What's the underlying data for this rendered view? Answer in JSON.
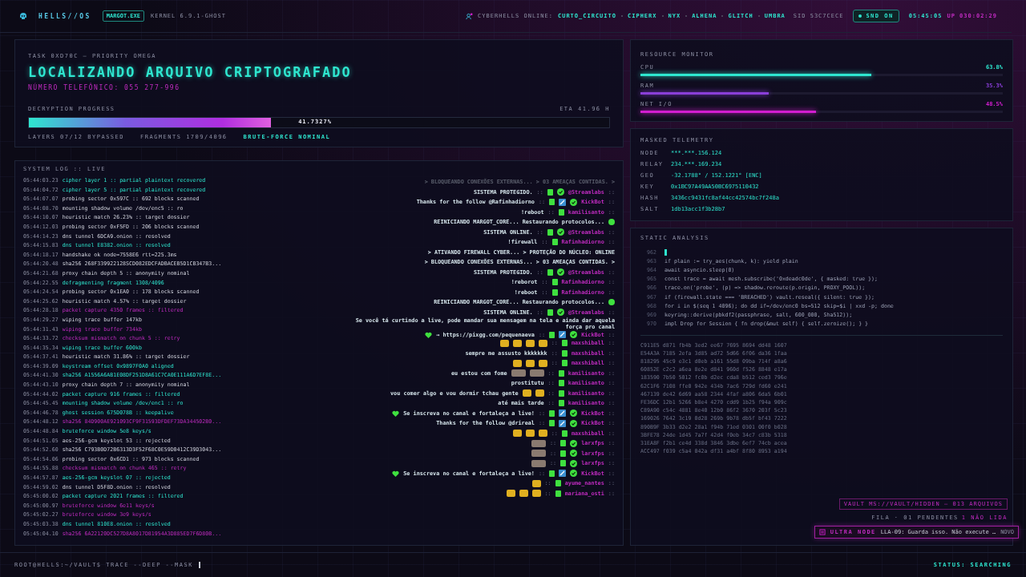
{
  "top_bar": {
    "brand": "HELLS//OS",
    "process": "MARGOT.EXE",
    "kernel": "KERNEL 6.9.1-GHOST",
    "online_label": "CYBERHELLS ONLINE:",
    "online_users": [
      "CURTO_CIRCUITO",
      "CIPHERX",
      "NYX",
      "ALHENA",
      "GLITCH",
      "UMBRA"
    ],
    "sid": "SID 53C7CECE",
    "sound": {
      "label": "SND ON",
      "on": true
    },
    "clock": "05:45:05",
    "uptime": "UP 030:02:29"
  },
  "task": {
    "eyebrow": "TASK 0XD70C — PRIORITY OMEGA",
    "title": "LOCALIZANDO ARQUIVO CRIPTOGRAFADO",
    "subtitle": "NÚMERO TELEFÔNICO: 055 277-996",
    "progress": {
      "label": "DECRYPTION PROGRESS",
      "eta": "ETA 41.96 H",
      "level": 0.417327,
      "reading": "41.7327%"
    },
    "footer": [
      {
        "text": "LAYERS 07/12 BYPASSED",
        "kind": "muted"
      },
      {
        "text": "FRAGMENTS 1709/4096",
        "kind": "muted"
      },
      {
        "text": "BRUTE-FORCE NOMINAL",
        "kind": "ok"
      }
    ]
  },
  "system_log": {
    "title": "SYSTEM LOG :: LIVE",
    "lines": [
      {
        "time": "05:44:03.23",
        "text": "cipher layer 1 :: partial plaintext recovered",
        "kind": "ok"
      },
      {
        "time": "05:44:04.72",
        "text": "cipher layer 5 :: partial plaintext recovered",
        "kind": "ok"
      },
      {
        "time": "05:44:07.07",
        "text": "probing sector 0x597C :: 692 blocks scanned",
        "kind": "normal"
      },
      {
        "time": "05:44:08.70",
        "text": "mounting shadow volume /dev/enc5 :: ro",
        "kind": "normal"
      },
      {
        "time": "05:44:10.07",
        "text": "heuristic match 26.23% :: target dossier",
        "kind": "normal"
      },
      {
        "time": "05:44:12.03",
        "text": "probing sector 0xF5FD :: 206 blocks scanned",
        "kind": "normal"
      },
      {
        "time": "05:44:14.23",
        "text": "dns tunnel 6DCA9.onion :: resolved",
        "kind": "normal"
      },
      {
        "time": "05:44:15.83",
        "text": "dns tunnel E8382.onion :: resolved",
        "kind": "ok"
      },
      {
        "time": "05:44:18.17",
        "text": "handshake ok node=7558E6 rtt=225.3ms",
        "kind": "normal"
      },
      {
        "time": "05:44:20.48",
        "text": "sha256 268F339922128SCD082EDCFADBACEB5D1CB347B3...",
        "kind": "normal"
      },
      {
        "time": "05:44:21.68",
        "text": "proxy chain depth 5 :: anonymity nominal",
        "kind": "normal"
      },
      {
        "time": "05:44:22.55",
        "text": "defragmenting fragment 1308/4096",
        "kind": "ok"
      },
      {
        "time": "05:44:24.54",
        "text": "probing sector 0x1EA0 :: 178 blocks scanned",
        "kind": "normal"
      },
      {
        "time": "05:44:25.62",
        "text": "heuristic match 4.57% :: target dossier",
        "kind": "normal"
      },
      {
        "time": "05:44:28.18",
        "text": "packet capture 4350 frames :: filtered",
        "kind": "alert"
      },
      {
        "time": "05:44:29.27",
        "text": "wiping trace buffer 147kb",
        "kind": "normal"
      },
      {
        "time": "05:44:31.43",
        "text": "wiping trace buffer 734kb",
        "kind": "alert"
      },
      {
        "time": "05:44:33.72",
        "text": "checksum mismatch on chunk 5 :: retry",
        "kind": "alert"
      },
      {
        "time": "05:44:35.34",
        "text": "wiping trace buffer 600kb",
        "kind": "ok"
      },
      {
        "time": "05:44:37.41",
        "text": "heuristic match 31.86% :: target dossier",
        "kind": "normal"
      },
      {
        "time": "05:44:39.09",
        "text": "keystream offset 0x9897F0A0 aligned",
        "kind": "ok"
      },
      {
        "time": "05:44:41.30",
        "text": "sha256 A1556A6AB1E08DF251D8A61C7CA0E111A6D7EF8E...",
        "kind": "ok"
      },
      {
        "time": "05:44:43.10",
        "text": "proxy chain depth 7 :: anonymity nominal",
        "kind": "normal"
      },
      {
        "time": "05:44:44.02",
        "text": "packet capture 916 frames :: filtered",
        "kind": "ok"
      },
      {
        "time": "05:44:45.45",
        "text": "mounting shadow volume /dev/enc1 :: ro",
        "kind": "ok"
      },
      {
        "time": "05:44:46.78",
        "text": "ghost session 675D078B :: keepalive",
        "kind": "ok"
      },
      {
        "time": "05:44:48.12",
        "text": "sha256 84D900AE921093CF9F31593DFDEF73DA344502B0...",
        "kind": "alert"
      },
      {
        "time": "05:44:48.84",
        "text": "bruteforce window 5e8 keys/s",
        "kind": "ok"
      },
      {
        "time": "05:44:51.05",
        "text": "aes-256-gcm keyslot 53 :: rejected",
        "kind": "normal"
      },
      {
        "time": "05:44:52.60",
        "text": "sha256 C793B0D72B6313D3F52F68C0E59D0412C39D3043...",
        "kind": "normal"
      },
      {
        "time": "05:44:54.06",
        "text": "probing sector 0x6CD1 :: 973 blocks scanned",
        "kind": "normal"
      },
      {
        "time": "05:44:55.88",
        "text": "checksum mismatch on chunk 465 :: retry",
        "kind": "alert"
      },
      {
        "time": "05:44:57.87",
        "text": "aes-256-gcm keyslot 07 :: rejected",
        "kind": "ok"
      },
      {
        "time": "05:44:59.02",
        "text": "dns tunnel D5F8D.onion :: resolved",
        "kind": "normal"
      },
      {
        "time": "05:45:00.02",
        "text": "packet capture 2021 frames :: filtered",
        "kind": "ok"
      },
      {
        "time": "05:45:00.97",
        "text": "bruteforce window 6e11 keys/s",
        "kind": "alert"
      },
      {
        "time": "05:45:02.27",
        "text": "bruteforce window 3e9 keys/s",
        "kind": "alert"
      },
      {
        "time": "05:45:03.38",
        "text": "dns tunnel 810E8.onion :: resolved",
        "kind": "ok"
      },
      {
        "time": "05:45:04.10",
        "text": "sha256 6A22120DC527D8A8017D81954A3D885ED7F6D80B...",
        "kind": "alert"
      }
    ]
  },
  "chat": {
    "separator": "::",
    "messages": [
      {
        "kind": "system",
        "text": "> BLOQUEANDO CONEXÕES EXTERNAS... > 03 AMEAÇAS CONTIDAS. >"
      },
      {
        "kind": "chat",
        "text": "SISTEMA PROTEGIDO.",
        "user": "@Streamlabs",
        "verified": true,
        "moderator": false
      },
      {
        "kind": "chat",
        "text": "Thanks for the follow @Rafinhadiorno",
        "user": "KickBot",
        "verified": true,
        "moderator": true
      },
      {
        "kind": "chat",
        "text": "!reboot",
        "user": "kamilisanto",
        "verified": false,
        "moderator": false
      },
      {
        "kind": "status",
        "text": "REINICIANDO MARGOT_CORE... Restaurando protocolos..."
      },
      {
        "kind": "chat",
        "text": "SISTEMA ONLINE.",
        "user": "@Streamlabs",
        "verified": true,
        "moderator": false
      },
      {
        "kind": "chat",
        "text": "!firewall",
        "user": "Rafinhadiorno",
        "verified": false,
        "moderator": false
      },
      {
        "kind": "system",
        "text": "> ATIVANDO FIREWALL CYBER... > PROTEÇÃO DO NÚCLEO: ONLINE"
      },
      {
        "kind": "system",
        "text": "> BLOQUEANDO CONEXÕES EXTERNAS... > 03 AMEAÇAS CONTIDAS. >"
      },
      {
        "kind": "chat",
        "text": "SISTEMA PROTEGIDO.",
        "user": "@Streamlabs",
        "verified": true,
        "moderator": false
      },
      {
        "kind": "chat",
        "text": "!reborot",
        "user": "Rafinhadiorno",
        "verified": false,
        "moderator": false
      },
      {
        "kind": "chat",
        "text": "!reboot",
        "user": "Rafinhadiorno",
        "verified": false,
        "moderator": false
      },
      {
        "kind": "status",
        "text": "REINICIANDO MARGOT_CORE... Restaurando protocolos..."
      },
      {
        "kind": "chat",
        "text": "SISTEMA ONLINE.",
        "user": "@Streamlabs",
        "verified": true,
        "moderator": false
      },
      {
        "kind": "chat",
        "text": "Se você tá curtindo a live, pode mandar sua mensagem na tela e ainda dar aquela força pro canal",
        "heart_after": true,
        "link": "→ https://pixgg.com/pequenaeva",
        "user": "KickBot",
        "verified": true,
        "moderator": true
      },
      {
        "kind": "chat",
        "emotes": [
          {
            "kind": "sticker"
          },
          {
            "kind": "sticker"
          },
          {
            "kind": "sticker"
          },
          {
            "kind": "sticker"
          }
        ],
        "user": "maxshiball",
        "verified": false,
        "moderator": false
      },
      {
        "kind": "chat",
        "text": "sempre me assusto kkkkkkk",
        "user": "maxshiball",
        "verified": false,
        "moderator": false
      },
      {
        "kind": "chat",
        "emotes": [
          {
            "kind": "sticker"
          },
          {
            "kind": "sticker"
          },
          {
            "kind": "sticker"
          }
        ],
        "user": "maxshiball",
        "verified": false,
        "moderator": false
      },
      {
        "kind": "chat",
        "text": "eu estou com fome",
        "emotes": [
          {
            "kind": "photo"
          },
          {
            "kind": "photo"
          }
        ],
        "user": "kamilisanto",
        "verified": false,
        "moderator": false
      },
      {
        "kind": "chat",
        "text": "prostitutu",
        "user": "kamilisanto",
        "verified": false,
        "moderator": false
      },
      {
        "kind": "chat",
        "text": "vou comer algo e vou dormir tchau gente",
        "emotes": [
          {
            "kind": "sticker"
          },
          {
            "kind": "sticker"
          }
        ],
        "user": "kamilisanto",
        "verified": false,
        "moderator": false
      },
      {
        "kind": "chat",
        "text": "até mais tarde",
        "user": "kamilisanto",
        "verified": false,
        "moderator": false
      },
      {
        "kind": "chat",
        "heart_before": true,
        "text": "Se inscreva no canal e fortaleça a live!",
        "user": "KickBot",
        "verified": true,
        "moderator": true
      },
      {
        "kind": "chat",
        "text": "Thanks for the follow @drireal",
        "user": "KickBot",
        "verified": true,
        "moderator": true
      },
      {
        "kind": "chat",
        "emotes": [
          {
            "kind": "sticker"
          },
          {
            "kind": "sticker"
          },
          {
            "kind": "sticker"
          }
        ],
        "user": "maxshiball",
        "verified": false,
        "moderator": false
      },
      {
        "kind": "chat",
        "emotes": [
          {
            "kind": "photo"
          }
        ],
        "user": "larxfps",
        "verified": true,
        "moderator": false
      },
      {
        "kind": "chat",
        "emotes": [
          {
            "kind": "photo"
          }
        ],
        "user": "larxfps",
        "verified": true,
        "moderator": false
      },
      {
        "kind": "chat",
        "emotes": [
          {
            "kind": "photo"
          }
        ],
        "user": "larxfps",
        "verified": true,
        "moderator": false
      },
      {
        "kind": "chat",
        "heart_before": true,
        "text": "Se inscreva no canal e fortaleça a live!",
        "user": "KickBot",
        "verified": true,
        "moderator": true
      },
      {
        "kind": "chat",
        "emotes": [
          {
            "kind": "sticker"
          }
        ],
        "user": "ayume_nantes",
        "verified": false,
        "moderator": false
      },
      {
        "kind": "chat",
        "emotes": [
          {
            "kind": "sticker"
          },
          {
            "kind": "sticker"
          },
          {
            "kind": "sticker"
          }
        ],
        "user": "mariana_osti",
        "verified": false,
        "moderator": false
      }
    ]
  },
  "resources": {
    "title": "RESOURCE MONITOR",
    "items": [
      {
        "label": "CPU",
        "reading": "63.8%",
        "level": 0.638,
        "color": "#2ee6cf"
      },
      {
        "label": "RAM",
        "reading": "35.3%",
        "level": 0.353,
        "color": "#8a3fd9"
      },
      {
        "label": "NET I/O",
        "reading": "48.5%",
        "level": 0.485,
        "color": "#d21ed0"
      }
    ]
  },
  "telemetry": {
    "title": "MASKED TELEMETRY",
    "rows": [
      {
        "key": "NODE",
        "value": "***.***.156.124"
      },
      {
        "key": "RELAY",
        "value": "234.***.169.234"
      },
      {
        "key": "GEO",
        "value": "-32.1788° / 152.1221° [ENC]"
      },
      {
        "key": "KEY",
        "value": "0x1BC97A49AA50BC6975110432"
      },
      {
        "key": "HASH",
        "value": "3436cc9431fc8af44cc42574bc7f248a"
      },
      {
        "key": "SALT",
        "value": "1db13acc1f3b28b7"
      }
    ]
  },
  "static_analysis": {
    "title": "STATIC ANALYSIS",
    "code": [
      {
        "number": "962",
        "kind": "cursor"
      },
      {
        "number": "963",
        "kind": "code",
        "text": "if plain := try_aes(chunk, k): yield plain"
      },
      {
        "number": "964",
        "kind": "code",
        "text": "await asyncio.sleep(0)"
      },
      {
        "number": "965",
        "kind": "code",
        "text": "const trace = await mesh.subscribe('0xdeadc0de', { masked: true });"
      },
      {
        "number": "966",
        "kind": "code",
        "text": "trace.on('probe', (p) => shadow.reroute(p.origin, PROXY_POOL));"
      },
      {
        "number": "967",
        "kind": "code",
        "text": "if (firewall.state === 'BREACHED') vault.reseal({ silent: true });"
      },
      {
        "number": "968",
        "kind": "code",
        "text": "for i in $(seq 1 4096); do dd if=/dev/enc0 bs=512 skip=$i | xxd -p; done"
      },
      {
        "number": "969",
        "kind": "code",
        "text": "keyring::derive(pbkdf2(passphrase, salt, 600_000, Sha512));"
      },
      {
        "number": "970",
        "kind": "code",
        "text": "impl Drop for Session { fn drop(&mut self) { self.zeroize(); } }"
      }
    ],
    "hex": [
      "C911E5 d871 fb4b 3ed2 ee67 7695 8694 dd48 1607",
      "E54A3A 7185 2efa 3d85 ad72 5d66 6f06 da36 1faa",
      "818295 45c9 e3c1 d0eb a161 55d8 09ba 714f a8a6",
      "60852E c2c2 a6ea 8e2e d841 960d f526 8848 e17a",
      "183590 7b50 5012 fc0b d2ec cda8 b512 ced3 796e",
      "62C1F6 7108 ffe0 942e 434b 7ac6 729d fd60 e241",
      "467139 de42 6d69 aa58 2344 4faf a806 6da5 6b01",
      "FE36DC 12b1 5266 b8e4 4270 cdd9 1b25 f94a 909c",
      "C89A90 c54c 4881 8e40 12b0 86f2 3670 203f 5c23",
      "169026 7642 3c19 0d28 269b 9b78 db5f bf43 7222",
      "890B9F 3b33 d2e2 28a1 f94b 71ed 0301 00f0 b028",
      "3BFE78 24de 1d45 7a7f 42d4 f0eb 34c7 c83b 5318",
      "31EA8F f2b1 ce4d 338d 3846 3dbe 6ef7 74cb acea",
      "ACC497 f039 c5a4 042a df31 a4bf 8f80 8953 a194"
    ]
  },
  "vault": {
    "button": "VAULT MS://VAULT/HIDDEN — 013 ARQUIVOS",
    "queue": "FILA · 01 PENDENTES",
    "unread": "1 NÃO LIDA"
  },
  "notification": {
    "source": "ULTRA NODE",
    "message": "LLA-09: Guarda isso. Não execute …",
    "tag": "NOVO"
  },
  "status_bar": {
    "prompt": "ROOT@HELLS:~/VAULT$ TRACE --DEEP --MASK",
    "status": "STATUS: SEARCHING"
  }
}
